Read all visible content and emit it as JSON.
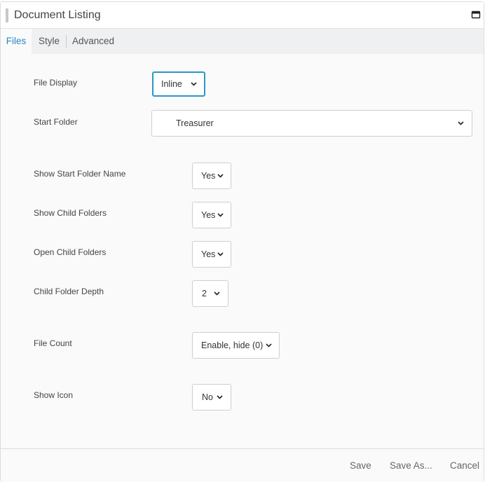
{
  "window": {
    "title": "Document Listing"
  },
  "tabs": [
    {
      "label": "Files",
      "active": true
    },
    {
      "label": "Style",
      "active": false
    },
    {
      "label": "Advanced",
      "active": false
    }
  ],
  "fields": {
    "file_display": {
      "label": "File Display",
      "value": "Inline"
    },
    "start_folder": {
      "label": "Start Folder",
      "value": "Treasurer"
    },
    "show_start_folder_name": {
      "label": "Show Start Folder Name",
      "value": "Yes"
    },
    "show_child_folders": {
      "label": "Show Child Folders",
      "value": "Yes"
    },
    "open_child_folders": {
      "label": "Open Child Folders",
      "value": "Yes"
    },
    "child_folder_depth": {
      "label": "Child Folder Depth",
      "value": "2"
    },
    "file_count": {
      "label": "File Count",
      "value": "Enable, hide (0)"
    },
    "show_icon": {
      "label": "Show Icon",
      "value": "No"
    }
  },
  "footer": {
    "save": "Save",
    "save_as": "Save As...",
    "cancel": "Cancel"
  },
  "colors": {
    "accent": "#2a86c4",
    "focus_border": "#2a97c7"
  }
}
